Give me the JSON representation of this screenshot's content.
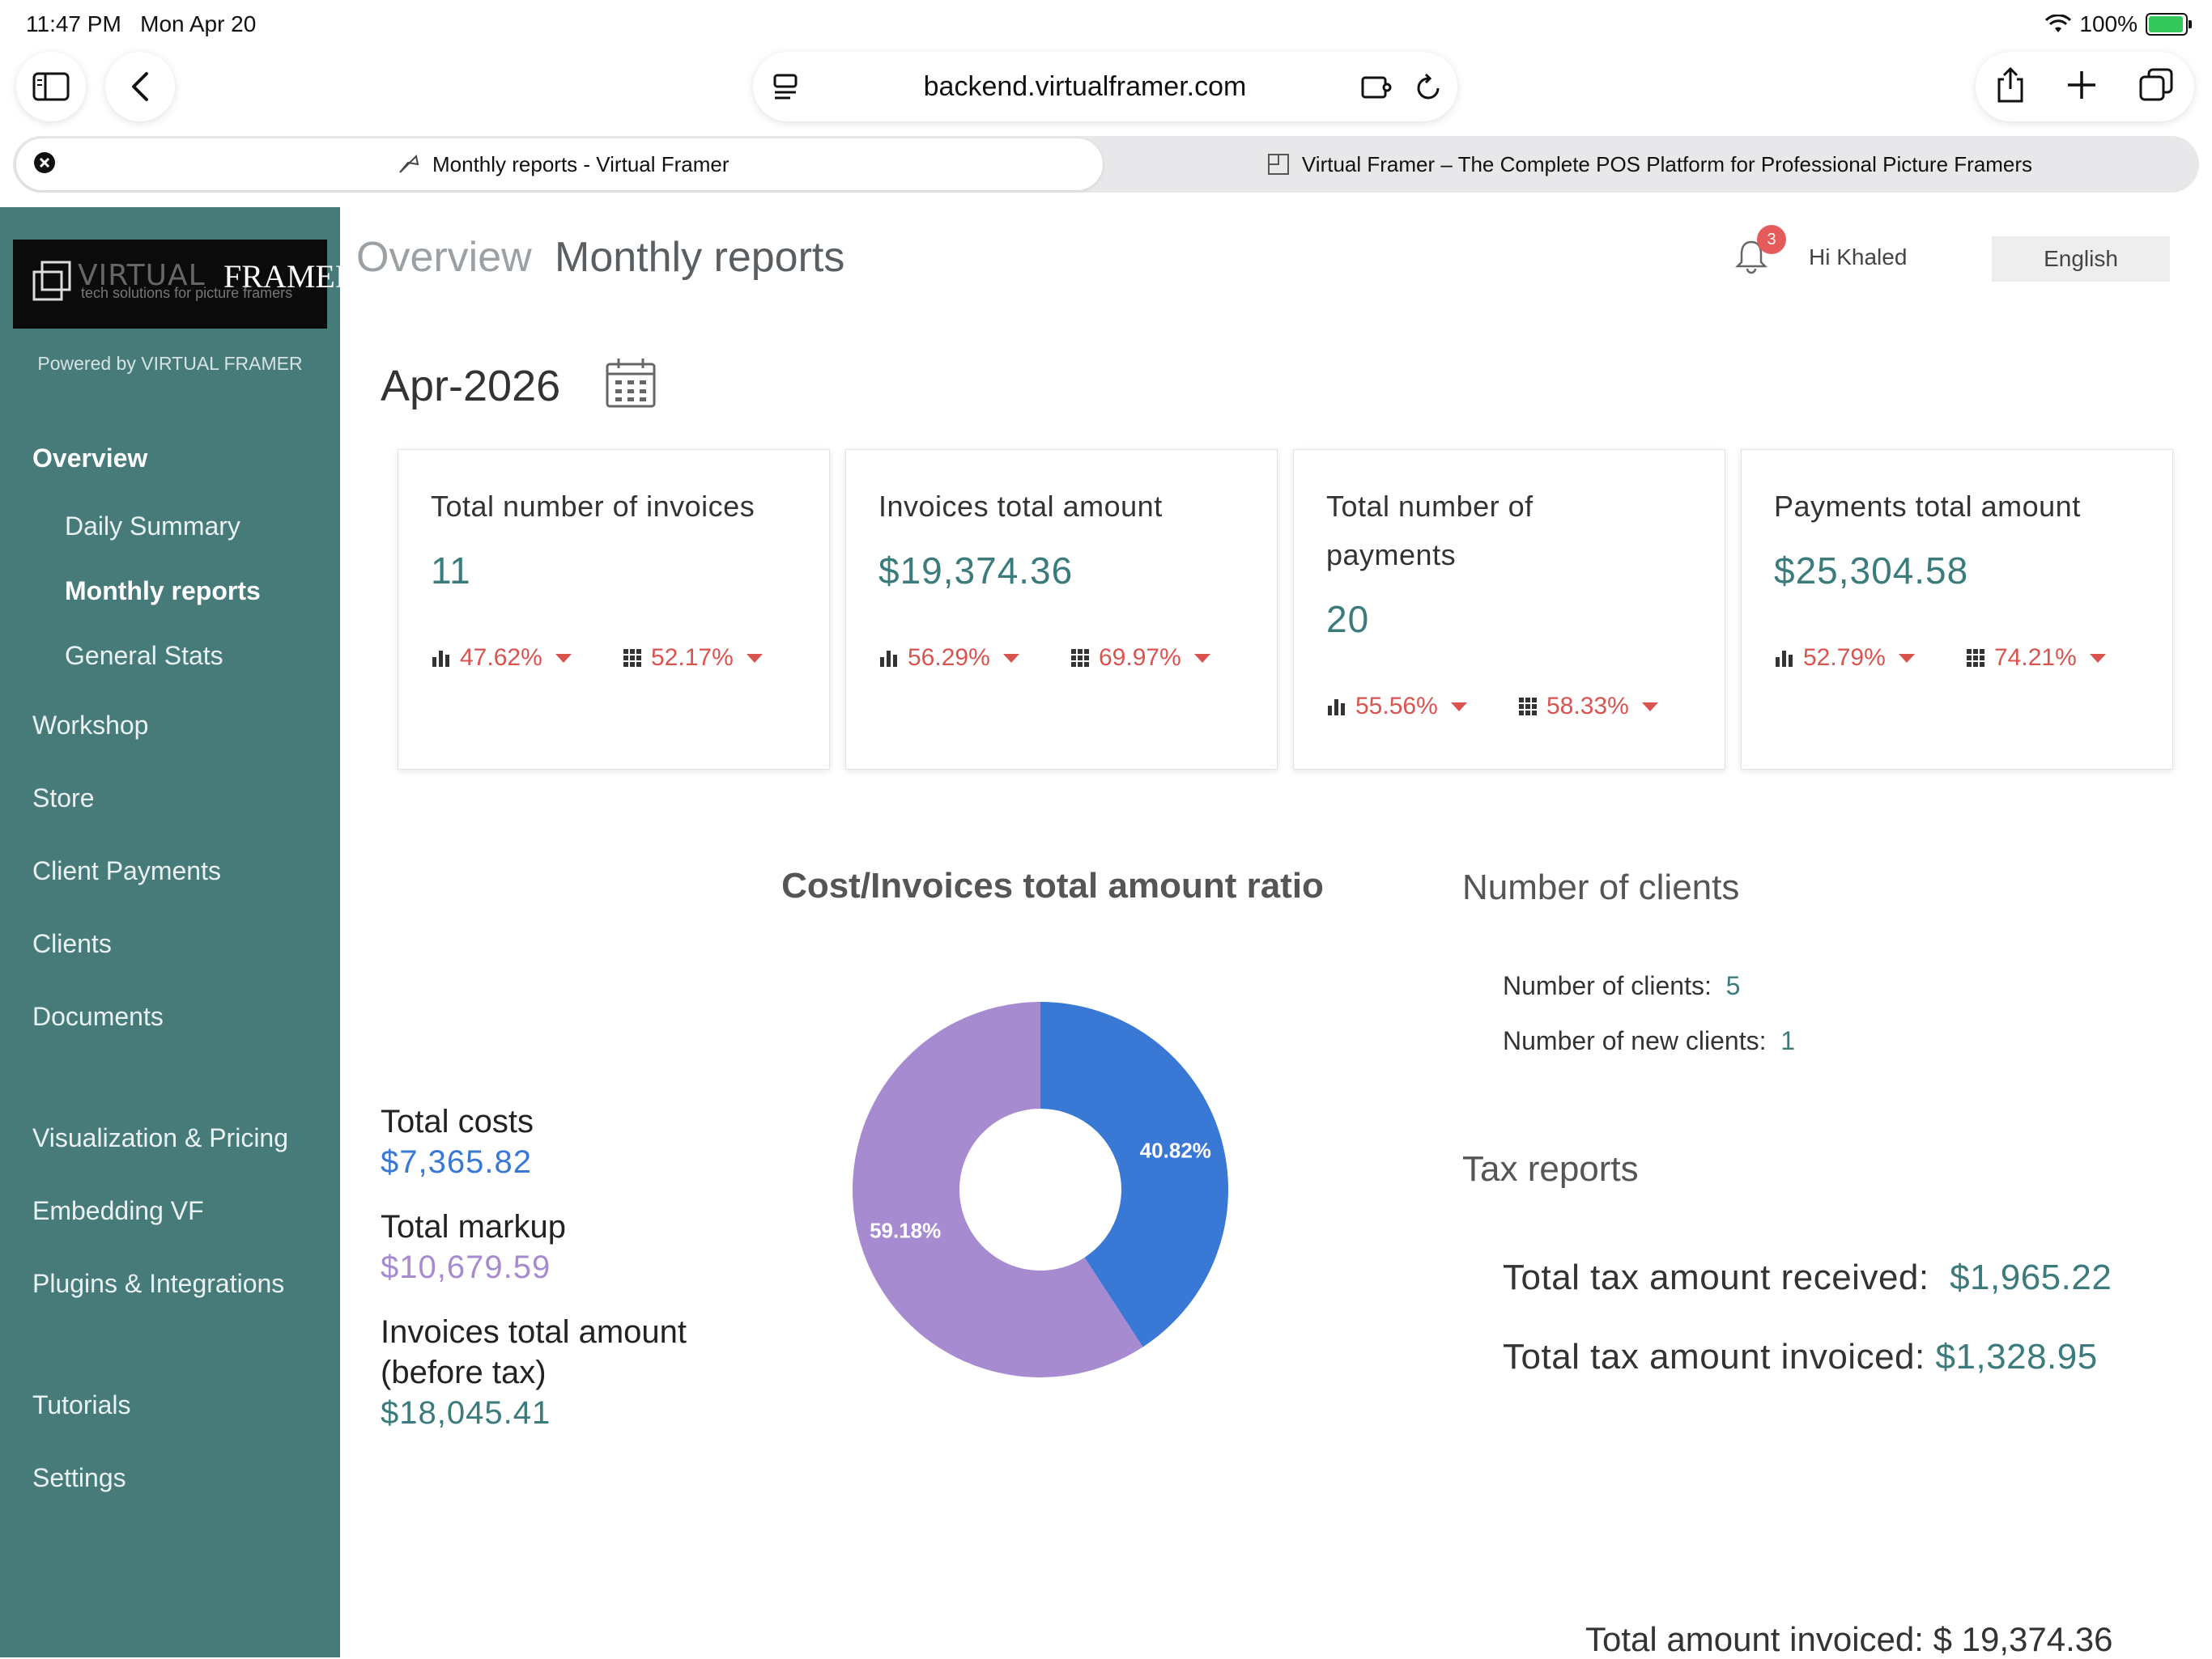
{
  "status_bar": {
    "time": "11:47 PM",
    "date": "Mon Apr 20",
    "battery": "100%",
    "battery_level": 1.0
  },
  "browser": {
    "url": "backend.virtualframer.com",
    "tabs": [
      {
        "title": "Monthly reports - Virtual Framer",
        "active": true
      },
      {
        "title": "Virtual Framer – The Complete POS Platform for Professional Picture Framers",
        "active": false
      }
    ]
  },
  "logo": {
    "word_a": "VIRTUAL",
    "word_b": "FRAMER",
    "tagline": "tech solutions for picture framers"
  },
  "sidebar": {
    "powered_by": "Powered by VIRTUAL FRAMER",
    "items": [
      {
        "label": "Overview",
        "bold": true
      },
      {
        "label": "Daily Summary"
      },
      {
        "label": "Monthly reports",
        "bold": true
      },
      {
        "label": "General Stats"
      },
      {
        "label": "Workshop"
      },
      {
        "label": "Store"
      },
      {
        "label": "Client Payments"
      },
      {
        "label": "Clients"
      },
      {
        "label": "Documents"
      },
      {
        "label": "Visualization & Pricing"
      },
      {
        "label": "Embedding VF"
      },
      {
        "label": "Plugins & Integrations"
      },
      {
        "label": "Tutorials"
      },
      {
        "label": "Settings"
      }
    ]
  },
  "header": {
    "breadcrumb_root": "Overview",
    "page_title": "Monthly reports",
    "notification_count": "3",
    "greeting": "Hi Khaled",
    "language": "English"
  },
  "period": "Apr-2026",
  "cards": [
    {
      "title": "Total number of invoices",
      "value": "11",
      "stat1": "47.62%",
      "stat2": "52.17%"
    },
    {
      "title": "Invoices total amount",
      "value": "$19,374.36",
      "stat1": "56.29%",
      "stat2": "69.97%"
    },
    {
      "title": "Total number of payments",
      "value": "20",
      "stat1": "55.56%",
      "stat2": "58.33%"
    },
    {
      "title": "Payments total amount",
      "value": "$25,304.58",
      "stat1": "52.79%",
      "stat2": "74.21%"
    }
  ],
  "ratio_section": {
    "title": "Cost/Invoices total amount ratio",
    "total_costs_label": "Total costs",
    "total_costs": "$7,365.82",
    "total_markup_label": "Total markup",
    "total_markup": "$10,679.59",
    "invoices_before_tax_label_1": "Invoices total amount",
    "invoices_before_tax_label_2": "(before tax)",
    "invoices_before_tax": "$18,045.41"
  },
  "chart_data": {
    "type": "pie",
    "title": "Cost/Invoices total amount ratio",
    "donut": true,
    "slices": [
      {
        "label": "Total costs",
        "value": 40.82,
        "display": "40.82%",
        "color": "#3a78d6"
      },
      {
        "label": "Total markup",
        "value": 59.18,
        "display": "59.18%",
        "color": "#a78bd0"
      }
    ]
  },
  "clients": {
    "title": "Number of clients",
    "count_label": "Number of clients:",
    "count": "5",
    "new_label": "Number of new clients:",
    "new_count": "1"
  },
  "tax": {
    "title": "Tax reports",
    "received_label": "Total tax amount received:",
    "received": "$1,965.22",
    "invoiced_label": "Total tax amount invoiced:",
    "invoiced": "$1,328.95"
  },
  "footer_total": "Total amount invoiced: $ 19,374.36"
}
